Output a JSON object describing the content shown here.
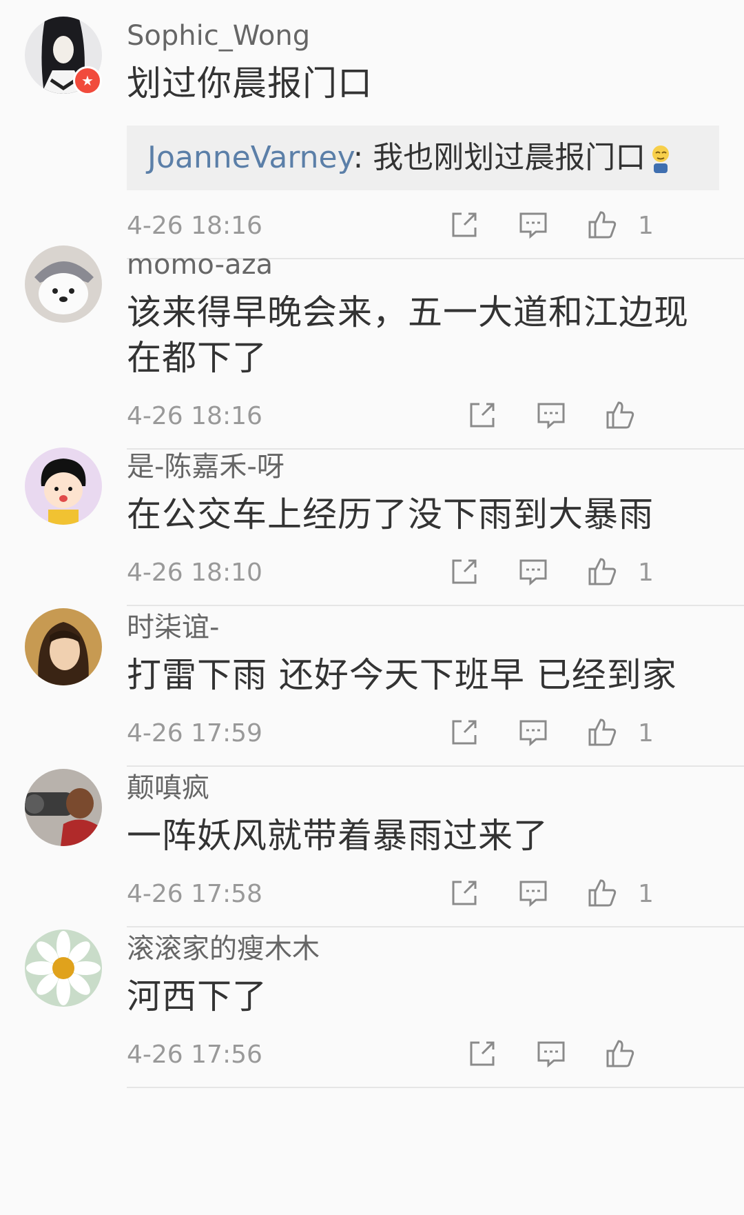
{
  "comments": [
    {
      "name": "Sophic_Wong",
      "text": "划过你晨报门口",
      "verified": true,
      "reply": {
        "name": "JoanneVarney",
        "sep": ": ",
        "text": "我也刚划过晨报门口"
      },
      "time": "4-26 18:16",
      "likes": "1",
      "avatar": "woman-portrait-avatar"
    },
    {
      "name": "momo-aza",
      "text": "该来得早晚会来，五一大道和江边现在都下了",
      "time": "4-26 18:16",
      "likes": "",
      "avatar": "white-dog-hat-avatar"
    },
    {
      "name": "是-陈嘉禾-呀",
      "text": "在公交车上经历了没下雨到大暴雨",
      "time": "4-26 18:10",
      "likes": "1",
      "avatar": "cartoon-girl-avatar"
    },
    {
      "name": "时柒谊-",
      "text": "打雷下雨 还好今天下班早 已经到家",
      "time": "4-26 17:59",
      "likes": "1",
      "avatar": "girl-photo-avatar"
    },
    {
      "name": "颠嗔疯",
      "text": "一阵妖风就带着暴雨过来了",
      "time": "4-26 17:58",
      "likes": "1",
      "avatar": "camera-man-avatar"
    },
    {
      "name": "滚滚家的瘦木木",
      "text": "河西下了",
      "time": "4-26 17:56",
      "likes": "",
      "avatar": "daisy-flower-avatar"
    }
  ],
  "colors": {
    "background": "#fafafa",
    "name": "#666666",
    "text": "#333333",
    "meta": "#999999",
    "reply_name": "#5b7fa8",
    "verified_badge": "#f14b3c"
  },
  "icons": [
    "share-icon",
    "comment-icon",
    "like-icon"
  ]
}
